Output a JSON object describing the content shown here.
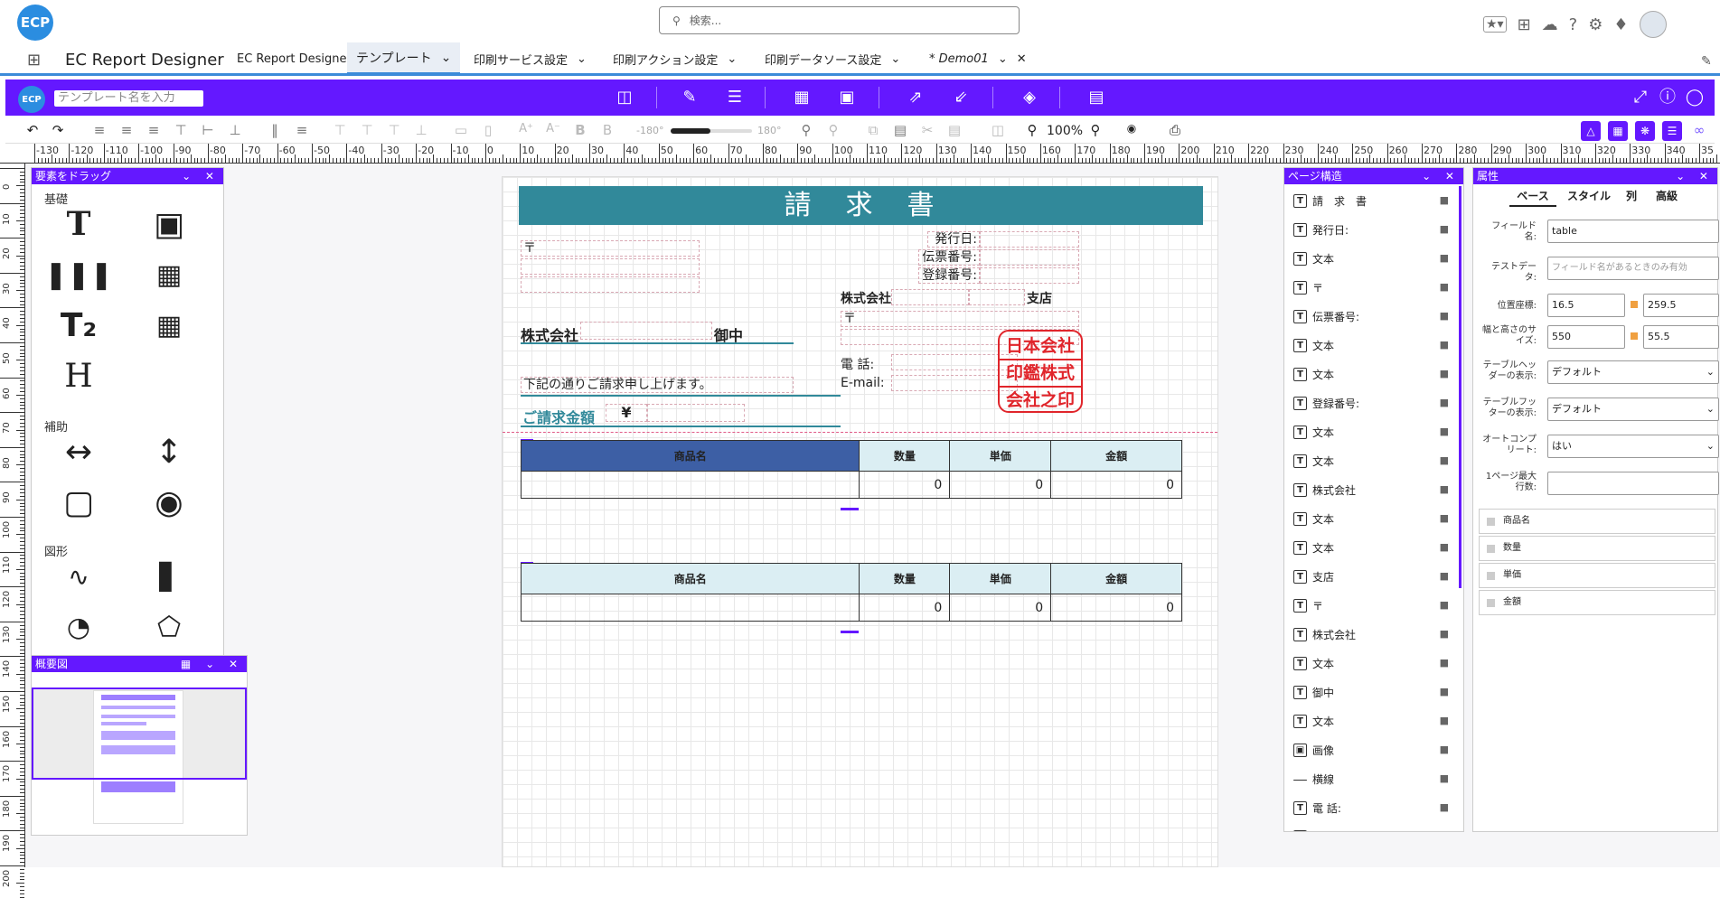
{
  "header": {
    "logo": "ECP",
    "search_placeholder": "検索...",
    "app_name": "EC Report Designer",
    "tabs": [
      {
        "label": "EC Report Designer"
      },
      {
        "label": "テンプレート",
        "active": true
      },
      {
        "label": "印刷サービス設定"
      },
      {
        "label": "印刷アクション設定"
      },
      {
        "label": "印刷データソース設定"
      },
      {
        "label": "* Demo01"
      }
    ]
  },
  "designer": {
    "logo": "ECP",
    "template_name_placeholder": "テンプレート名を入力",
    "rotation_min": "-180°",
    "rotation_max": "180°",
    "zoom": "100%"
  },
  "ruler": {
    "h_ticks": [
      "-130",
      "-120",
      "-110",
      "-100",
      "-90",
      "-80",
      "-70",
      "-60",
      "-50",
      "-40",
      "-30",
      "-20",
      "-10",
      "0",
      "10",
      "20",
      "30",
      "40",
      "50",
      "60",
      "70",
      "80",
      "90",
      "100",
      "110",
      "120",
      "130",
      "140",
      "150",
      "160",
      "170",
      "180",
      "190",
      "200",
      "210",
      "220",
      "230",
      "240",
      "250",
      "260",
      "270",
      "280",
      "290",
      "300",
      "310",
      "320",
      "330",
      "340",
      "35"
    ],
    "v_ticks": [
      "0",
      "10",
      "20",
      "30",
      "40",
      "50",
      "60",
      "70",
      "80",
      "90",
      "100",
      "110",
      "120",
      "130",
      "140",
      "150",
      "160",
      "170",
      "180",
      "190",
      "200"
    ]
  },
  "palette": {
    "title": "要素をドラッグ",
    "sections": {
      "basic": "基礎",
      "aux": "補助",
      "shape": "図形"
    }
  },
  "overview": {
    "title": "概要図"
  },
  "invoice": {
    "title": "請　求　書",
    "issue_date": "発行日:",
    "slip_no": "伝票番号:",
    "reg_no": "登録番号:",
    "postal_left": "〒",
    "company_right": "株式会社",
    "branch": "支店",
    "postal_right": "〒",
    "company_left": "株式会社",
    "onchu": "御中",
    "tel": "電 話:",
    "email": "E-mail:",
    "message": "下記の通りご請求申し上げます。",
    "amount_label": "ご請求金額",
    "yen": "¥",
    "stamp": [
      "日本会社",
      "印鑑株式",
      "会社之印"
    ],
    "table_headers": [
      "商品名",
      "数量",
      "単価",
      "金額"
    ],
    "table_values": [
      "",
      "0",
      "0",
      "0"
    ]
  },
  "page_structure": {
    "title": "ページ構造",
    "items": [
      {
        "icon": "text",
        "label": "請　求　書"
      },
      {
        "icon": "text",
        "label": "発行日:"
      },
      {
        "icon": "text",
        "label": "文本"
      },
      {
        "icon": "text",
        "label": "〒"
      },
      {
        "icon": "text",
        "label": "伝票番号:"
      },
      {
        "icon": "text",
        "label": "文本"
      },
      {
        "icon": "text",
        "label": "文本"
      },
      {
        "icon": "text",
        "label": "登録番号:"
      },
      {
        "icon": "text",
        "label": "文本"
      },
      {
        "icon": "text",
        "label": "文本"
      },
      {
        "icon": "text",
        "label": "株式会社"
      },
      {
        "icon": "text",
        "label": "文本"
      },
      {
        "icon": "text",
        "label": "文本"
      },
      {
        "icon": "text",
        "label": "支店"
      },
      {
        "icon": "text",
        "label": "〒"
      },
      {
        "icon": "text",
        "label": "株式会社"
      },
      {
        "icon": "text",
        "label": "文本"
      },
      {
        "icon": "text",
        "label": "御中"
      },
      {
        "icon": "text",
        "label": "文本"
      },
      {
        "icon": "image",
        "label": "画像"
      },
      {
        "icon": "line",
        "label": "横線"
      },
      {
        "icon": "text",
        "label": "電 話:"
      },
      {
        "icon": "text",
        "label": "文本"
      }
    ]
  },
  "properties": {
    "title": "属性",
    "tabs": [
      "ベース",
      "スタイル",
      "列",
      "高級"
    ],
    "field_name_label": "フィールド名:",
    "field_name_value": "table",
    "test_data_label": "テストデータ:",
    "test_data_placeholder": "フィールド名があるときのみ有効",
    "position_label": "位置座標:",
    "pos_x": "16.5",
    "pos_y": "259.5",
    "size_label": "幅と高さのサイズ:",
    "width": "550",
    "height": "55.5",
    "header_display_label": "テーブルヘッダーの表示:",
    "header_display_value": "デフォルト",
    "footer_display_label": "テーブルフッターの表示:",
    "footer_display_value": "デフォルト",
    "autocomplete_label": "オートコンプリート:",
    "autocomplete_value": "はい",
    "max_rows_label": "1ページ最大行数:",
    "columns": [
      "商品名",
      "数量",
      "単価",
      "金額"
    ]
  }
}
